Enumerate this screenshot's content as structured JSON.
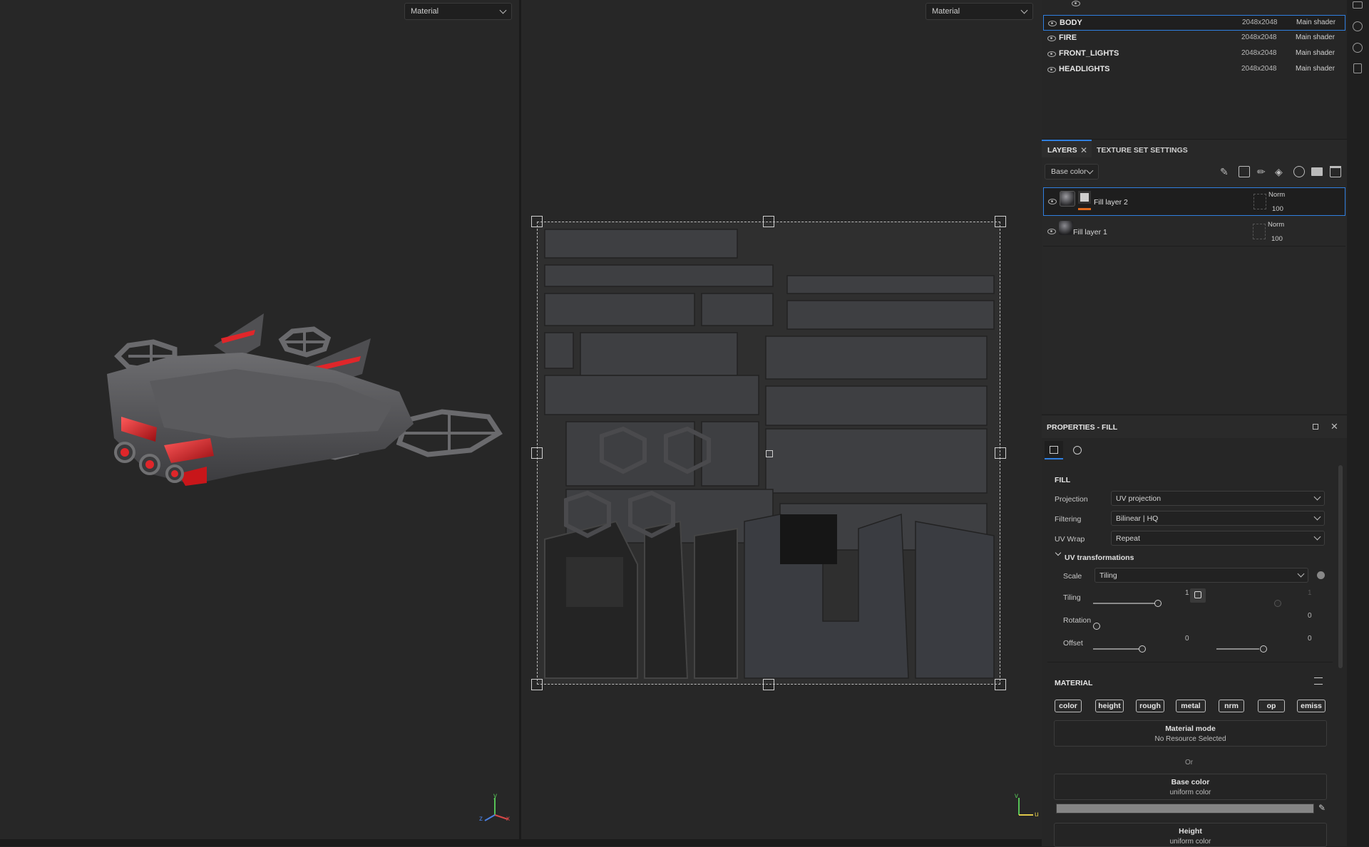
{
  "viewport3d": {
    "dropdown": "Material"
  },
  "viewport2d": {
    "dropdown": "Material"
  },
  "texture_sets": [
    {
      "name": "BODY",
      "resolution": "2048x2048",
      "shader": "Main shader"
    },
    {
      "name": "FIRE",
      "resolution": "2048x2048",
      "shader": "Main shader"
    },
    {
      "name": "FRONT_LIGHTS",
      "resolution": "2048x2048",
      "shader": "Main shader"
    },
    {
      "name": "HEADLIGHTS",
      "resolution": "2048x2048",
      "shader": "Main shader"
    }
  ],
  "layers_panel": {
    "tabs": [
      "LAYERS",
      "TEXTURE SET SETTINGS"
    ],
    "channel_dropdown": "Base color",
    "layers": [
      {
        "name": "Fill layer 2",
        "blend": "Norm",
        "opacity": "100"
      },
      {
        "name": "Fill layer 1",
        "blend": "Norm",
        "opacity": "100"
      }
    ]
  },
  "properties": {
    "title": "PROPERTIES - FILL",
    "fill_section": "FILL",
    "projection_label": "Projection",
    "projection_value": "UV projection",
    "filtering_label": "Filtering",
    "filtering_value": "Bilinear | HQ",
    "uvwrap_label": "UV Wrap",
    "uvwrap_value": "Repeat",
    "uv_transformations": "UV transformations",
    "scale_label": "Scale",
    "scale_value": "Tiling",
    "tiling_label": "Tiling",
    "tiling_value_1": "1",
    "tiling_value_2": "1",
    "rotation_label": "Rotation",
    "rotation_value": "0",
    "offset_label": "Offset",
    "offset_value_1": "0",
    "offset_value_2": "0",
    "material_section": "MATERIAL",
    "channels": [
      "color",
      "height",
      "rough",
      "metal",
      "nrm",
      "op",
      "emiss"
    ],
    "material_mode_title": "Material mode",
    "material_mode_value": "No Resource Selected",
    "or_text": "Or",
    "base_color_title": "Base color",
    "base_color_sub": "uniform color",
    "height_title": "Height",
    "height_sub": "uniform color"
  },
  "gizmo": {
    "x": "x",
    "y": "y",
    "z": "z",
    "u": "u",
    "v": "v"
  },
  "colors": {
    "accent": "#2f7fe0",
    "mask_orange": "#e06a1e",
    "ship_red": "#e0262a"
  }
}
